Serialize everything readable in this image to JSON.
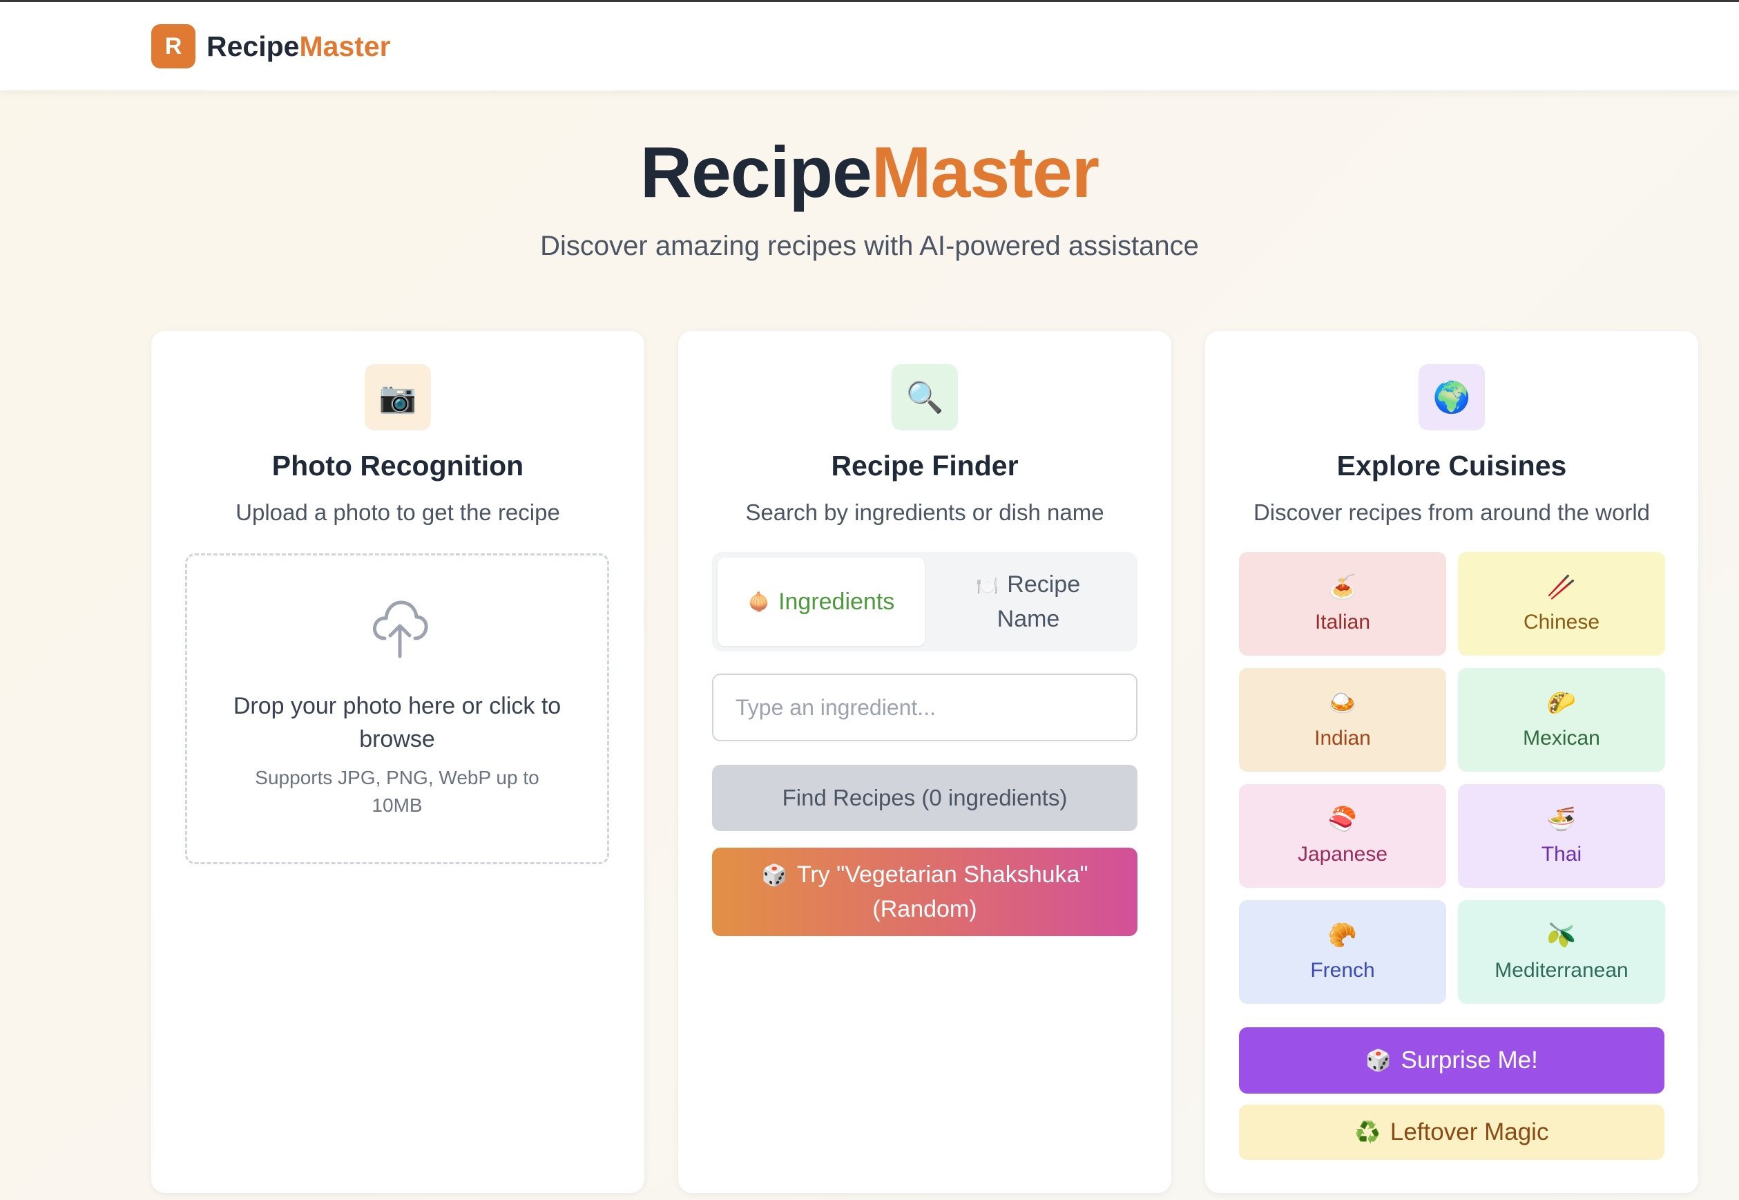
{
  "navbar": {
    "logo_letter": "R",
    "brand_part1": "Recipe",
    "brand_part2": "Master"
  },
  "hero": {
    "title_part1": "Recipe",
    "title_part2": "Master",
    "subtitle": "Discover amazing recipes with AI-powered assistance"
  },
  "photo_card": {
    "icon": "📷",
    "title": "Photo Recognition",
    "subtitle": "Upload a photo to get the recipe",
    "drop_text": "Drop your photo here or click to browse",
    "drop_note": "Supports JPG, PNG, WebP up to 10MB"
  },
  "finder_card": {
    "icon": "🔍",
    "title": "Recipe Finder",
    "subtitle": "Search by ingredients or dish name",
    "tabs": [
      {
        "icon": "🧅",
        "label": "Ingredients"
      },
      {
        "icon": "🍽️",
        "label": "Recipe Name"
      }
    ],
    "input_placeholder": "Type an ingredient...",
    "find_button": "Find Recipes (0 ingredients)",
    "try_button_icon": "🎲",
    "try_button": "Try \"Vegetarian Shakshuka\" (Random)"
  },
  "cuisines_card": {
    "icon": "🌍",
    "title": "Explore Cuisines",
    "subtitle": "Discover recipes from around the world",
    "cuisines": [
      {
        "icon": "🍝",
        "label": "Italian",
        "bg": "#f9e1e1",
        "color": "#9b2c2c"
      },
      {
        "icon": "🥢",
        "label": "Chinese",
        "bg": "#fbf6c5",
        "color": "#8a5a12"
      },
      {
        "icon": "🍛",
        "label": "Indian",
        "bg": "#f9ead3",
        "color": "#a0451a"
      },
      {
        "icon": "🌮",
        "label": "Mexican",
        "bg": "#e0f6e6",
        "color": "#2f6b3c"
      },
      {
        "icon": "🍣",
        "label": "Japanese",
        "bg": "#f8e3ef",
        "color": "#9b2c5c"
      },
      {
        "icon": "🍜",
        "label": "Thai",
        "bg": "#efe4fb",
        "color": "#6b2fb0"
      },
      {
        "icon": "🥐",
        "label": "French",
        "bg": "#e1e9fb",
        "color": "#3b4bb5"
      },
      {
        "icon": "🫒",
        "label": "Mediterranean",
        "bg": "#ddf7ee",
        "color": "#2f6b5b"
      }
    ],
    "surprise_icon": "🎲",
    "surprise_button": "Surprise Me!",
    "leftover_icon": "♻️",
    "leftover_button": "Leftover Magic"
  },
  "colors": {
    "accent": "#e07a33",
    "purple": "#9b51e8",
    "green": "#4d9a3c"
  }
}
